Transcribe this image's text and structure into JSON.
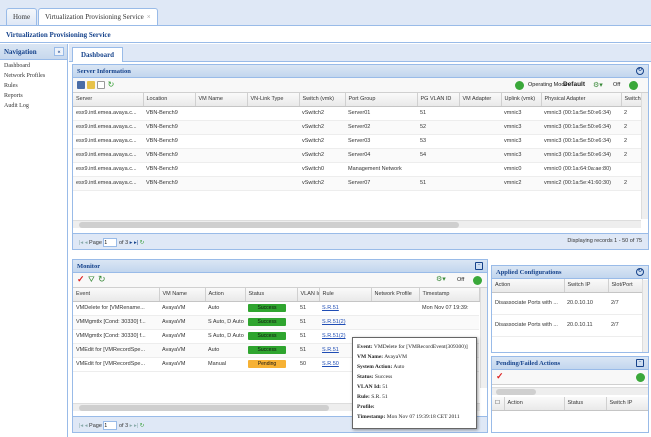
{
  "top_tabs": [
    {
      "label": "Home",
      "active": false
    },
    {
      "label": "Virtualization Provisioning Service",
      "active": true,
      "close": "×"
    }
  ],
  "app_title": "Virtualization Provisioning Service",
  "navigation": {
    "title": "Navigation",
    "collapse_glyph": "«",
    "items": [
      "Dashboard",
      "Network Profiles",
      "Rules",
      "Reports",
      "Audit Log"
    ]
  },
  "main_tab": "Dashboard",
  "server_info": {
    "title": "Server Information",
    "operating_mode_label": "Operating Mode:",
    "operating_mode_value": "Default",
    "off_label": "Off",
    "columns": [
      "Server",
      "Location",
      "VM Name",
      "VN-Link Type",
      "Switch (vmk)",
      "Port Group",
      "PG VLAN ID",
      "VM Adapter",
      "Uplink (vmk)",
      "Physical Adapter",
      "Switch"
    ],
    "rows": [
      [
        "esx9.intl.emea.avaya.c...",
        "VBN-Bench9",
        "",
        "",
        "vSwitch2",
        "Server01",
        "51",
        "",
        "vmnic3",
        "vmnic3 (00:1a:5e:50:e6:34)",
        "2"
      ],
      [
        "esx9.intl.emea.avaya.c...",
        "VBN-Bench9",
        "",
        "",
        "vSwitch2",
        "Server02",
        "52",
        "",
        "vmnic3",
        "vmnic3 (00:1a:5e:50:e6:34)",
        "2"
      ],
      [
        "esx9.intl.emea.avaya.c...",
        "VBN-Bench9",
        "",
        "",
        "vSwitch2",
        "Server03",
        "53",
        "",
        "vmnic3",
        "vmnic3 (00:1a:5e:50:e6:34)",
        "2"
      ],
      [
        "esx9.intl.emea.avaya.c...",
        "VBN-Bench9",
        "",
        "",
        "vSwitch2",
        "Server04",
        "54",
        "",
        "vmnic3",
        "vmnic3 (00:1a:5e:50:e6:34)",
        "2"
      ],
      [
        "esx9.intl.emea.avaya.c...",
        "VBN-Bench9",
        "",
        "",
        "vSwitch0",
        "Management Network",
        "",
        "",
        "vmnic0",
        "vmnic0 (00:1a:64:0a:ae:80)",
        ""
      ],
      [
        "esx9.intl.emea.avaya.c...",
        "VBN-Bench9",
        "",
        "",
        "vSwitch2",
        "Server07",
        "51",
        "",
        "vmnic2",
        "vmnic2 (00:1a:5e:41:60:30)",
        "2"
      ]
    ],
    "pager": {
      "page_label": "Page",
      "page": "1",
      "of_label": "of 3",
      "display": "Displaying records 1 - 50 of 75"
    }
  },
  "monitor": {
    "title": "Monitor",
    "off_label": "Off",
    "columns": [
      "Event",
      "VM Name",
      "Action",
      "Status",
      "VLAN Id",
      "Rule",
      "Network Profile",
      "Timestamp"
    ],
    "rows": [
      {
        "event": "VMDelete for [VMRename...",
        "vm": "AvayaVM",
        "action": "Auto",
        "status": "Success",
        "vlan": "51",
        "rule": "S.R.51",
        "profile": "",
        "time": "Mon Nov 07 19:39:"
      },
      {
        "event": "VMMgmtlx [Cond: 30330] f...",
        "vm": "AvayaVM",
        "action": "S Auto, D Auto",
        "status": "Success",
        "vlan": "51",
        "rule": "S.R.51(2)",
        "profile": "",
        "time": ""
      },
      {
        "event": "VMMgmtlx [Cond: 30330] f...",
        "vm": "AvayaVM",
        "action": "S Auto, D Auto",
        "status": "Success",
        "vlan": "51",
        "rule": "S.R.51(2)",
        "profile": "",
        "time": ""
      },
      {
        "event": "VMEdit for [VMRecordSpe...",
        "vm": "AvayaVM",
        "action": "Auto",
        "status": "Success",
        "vlan": "51",
        "rule": "S.R.51",
        "profile": "",
        "time": ""
      },
      {
        "event": "VMEdit for [VMRecordSpe...",
        "vm": "AvayaVM",
        "action": "Manual",
        "status": "Pending",
        "vlan": "50",
        "rule": "S.R.50",
        "profile": "",
        "time": ""
      }
    ],
    "pager": {
      "page_label": "Page",
      "page": "1",
      "of_label": "of 3"
    }
  },
  "tooltip": {
    "lines": [
      {
        "k": "Event:",
        "v": "VMDelete for [VMRecordEvent(309300)]"
      },
      {
        "k": "VM Name:",
        "v": "AvayaVM"
      },
      {
        "k": "System Action:",
        "v": "Auto"
      },
      {
        "k": "Status:",
        "v": "Success"
      },
      {
        "k": "VLAN Id:",
        "v": "51"
      },
      {
        "k": "Rule:",
        "v": "S.R. 51"
      },
      {
        "k": "Profile:",
        "v": ""
      },
      {
        "k": "Timestamp:",
        "v": "Mon Nov 07 19:39:18 CET 2011"
      }
    ]
  },
  "applied_configurations": {
    "title": "Applied Configurations",
    "columns": [
      "Action",
      "Switch IP",
      "Slot/Port"
    ],
    "rows": [
      [
        "Disassociate Ports with ...",
        "20.0.10.10",
        "2/7"
      ],
      [
        "Disassociate Ports with ...",
        "20.0.10.11",
        "2/7"
      ]
    ]
  },
  "pending_failed": {
    "title": "Pending/Failed Actions",
    "columns": [
      "Action",
      "Status",
      "Switch IP"
    ]
  },
  "colors": {
    "accent": "#15428b",
    "success": "#2fa52f",
    "pending": "#f6b134",
    "border": "#99bbe8"
  }
}
